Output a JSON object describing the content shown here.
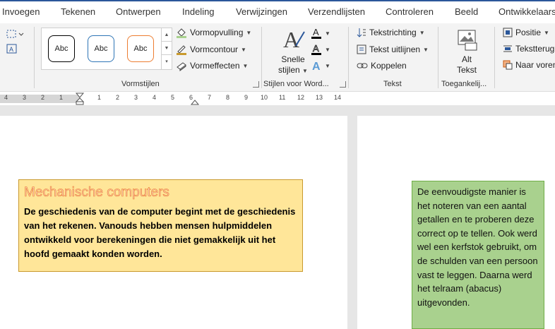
{
  "tabs": [
    "Invoegen",
    "Tekenen",
    "Ontwerpen",
    "Indeling",
    "Verwijzingen",
    "Verzendlijsten",
    "Controleren",
    "Beeld",
    "Ontwikkelaars"
  ],
  "shape_styles": {
    "previews": [
      "Abc",
      "Abc",
      "Abc"
    ],
    "fill_label": "Vormopvulling",
    "outline_label": "Vormcontour",
    "effects_label": "Vormeffecten",
    "group_label": "Vormstijlen"
  },
  "wordart": {
    "quick_styles_line1": "Snelle",
    "quick_styles_line2": "stijlen",
    "group_label": "Stijlen voor Word..."
  },
  "text_group": {
    "direction_label": "Tekstrichting",
    "align_label": "Tekst uitlijnen",
    "link_label": "Koppelen",
    "group_label": "Tekst"
  },
  "accessibility": {
    "alt_text_line1": "Alt",
    "alt_text_line2": "Tekst",
    "group_label": "Toegankelij..."
  },
  "arrange": {
    "position_label": "Positie",
    "wrap_label": "Tekstterugloop",
    "forward_label": "Naar voren"
  },
  "ruler": {
    "left_ticks": [
      "4",
      "3",
      "2",
      "1"
    ],
    "right_ticks": [
      "1",
      "2",
      "3",
      "4",
      "5",
      "6",
      "7",
      "8",
      "9",
      "10",
      "11",
      "12",
      "13",
      "14"
    ]
  },
  "document": {
    "orange_box": {
      "heading": "Mechanische computers",
      "body": "De geschiedenis van de computer begint met de geschiedenis van het rekenen. Vanouds hebben mensen hulpmiddelen ontwikkeld voor berekeningen die niet gemakkelijk uit het hoofd gemaakt konden worden."
    },
    "green_box": {
      "body": "De eenvoudigste manier is het noteren van een aantal getallen en te proberen deze correct op te tellen. Ook werd wel een kerfstok gebruikt, om de schulden van een persoon vast te leggen. Daarna werd het telraam (abacus) uitgevonden."
    }
  },
  "colors": {
    "accent_blue": "#2b579a",
    "orange_box_fill": "#ffe699",
    "orange_box_border": "#c99a2e",
    "heading_text": "#f8cbad",
    "heading_outline": "#ed7d31",
    "green_box_fill": "#a9d18e",
    "green_box_border": "#70ad47"
  }
}
